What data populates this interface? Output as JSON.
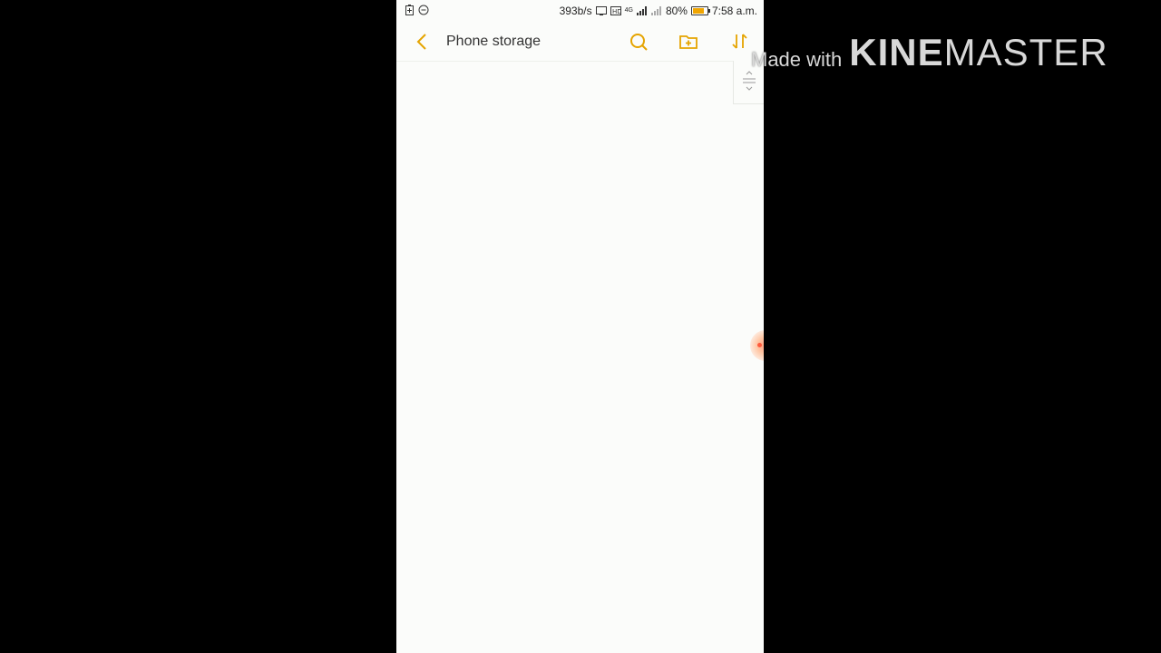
{
  "status_bar": {
    "net_speed": "393b/s",
    "network": "4G",
    "battery_text": "80%",
    "battery_level": 0.8,
    "time": "7:58 a.m."
  },
  "toolbar": {
    "title": "Phone storage",
    "icons": {
      "back": "back-arrow-icon",
      "search": "search-icon",
      "new_folder": "new-folder-icon",
      "sort": "sort-icon"
    },
    "accent_color": "#e5a400"
  },
  "watermark": {
    "prefix": "Made with",
    "brand_bold": "KINE",
    "brand_light": "MASTER"
  }
}
